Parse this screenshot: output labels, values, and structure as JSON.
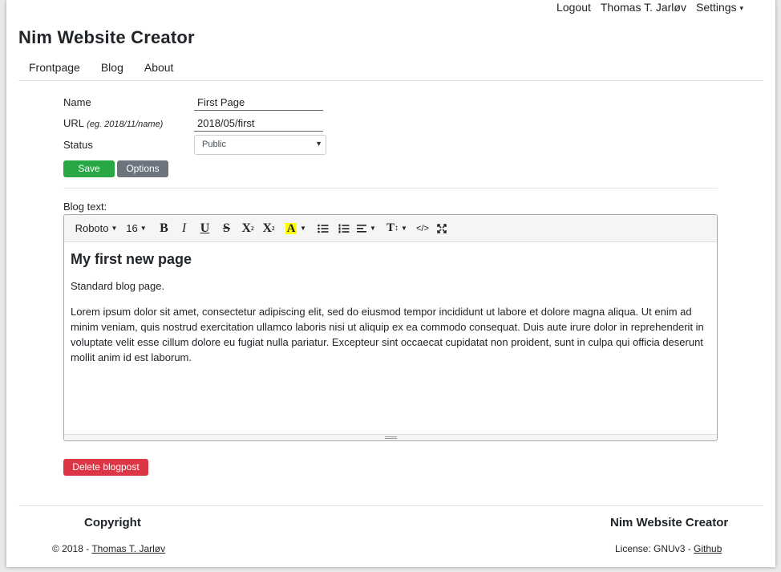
{
  "topbar": {
    "logout": "Logout",
    "user": "Thomas T. Jarløv",
    "settings": "Settings",
    "caret": "▾"
  },
  "site": {
    "title": "Nim Website Creator"
  },
  "nav": {
    "items": [
      "Frontpage",
      "Blog",
      "About"
    ]
  },
  "form": {
    "name_label": "Name",
    "name_value": "First Page",
    "url_label": "URL",
    "url_hint": "(eg. 2018/11/name)",
    "url_value": "2018/05/first",
    "status_label": "Status",
    "status_value": "Public",
    "save_label": "Save",
    "options_label": "Options",
    "blog_text_label": "Blog text:",
    "delete_label": "Delete blogpost"
  },
  "editor": {
    "toolbar": {
      "font": "Roboto",
      "size": "16",
      "bold": "B",
      "italic": "I",
      "underline": "U",
      "strike": "S",
      "superscript": "X",
      "subscript": "X",
      "color": "A",
      "code": "</>",
      "height": "T"
    },
    "icons": {
      "ul": "unordered-list-icon",
      "ol": "ordered-list-icon",
      "align": "align-icon",
      "fullscreen": "fullscreen-icon"
    },
    "heading": "My first new page",
    "para1": "Standard blog page.",
    "para2": "Lorem ipsum dolor sit amet, consectetur adipiscing elit, sed do eiusmod tempor incididunt ut labore et dolore magna aliqua. Ut enim ad minim veniam, quis nostrud exercitation ullamco laboris nisi ut aliquip ex ea commodo consequat. Duis aute irure dolor in reprehenderit in voluptate velit esse cillum dolore eu fugiat nulla pariatur. Excepteur sint occaecat cupidatat non proident, sunt in culpa qui officia deserunt mollit anim id est laborum."
  },
  "footer": {
    "copyright_title": "Copyright",
    "copyright_prefix": "© 2018 - ",
    "copyright_name": "Thomas T. Jarløv",
    "product_title": "Nim Website Creator",
    "license_prefix": "License: GNUv3 - ",
    "github": "Github"
  },
  "colors": {
    "save": "#28a745",
    "options": "#6c757d",
    "delete": "#dc3545",
    "highlight": "#ffff00"
  }
}
